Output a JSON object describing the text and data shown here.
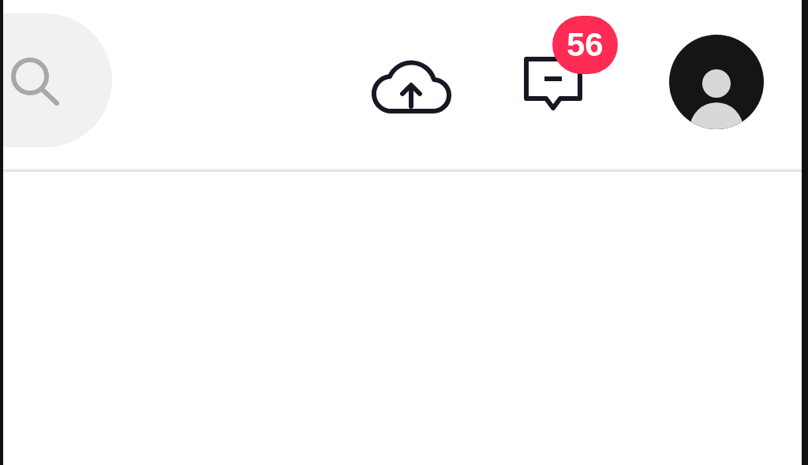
{
  "header": {
    "notification_badge": "56"
  }
}
